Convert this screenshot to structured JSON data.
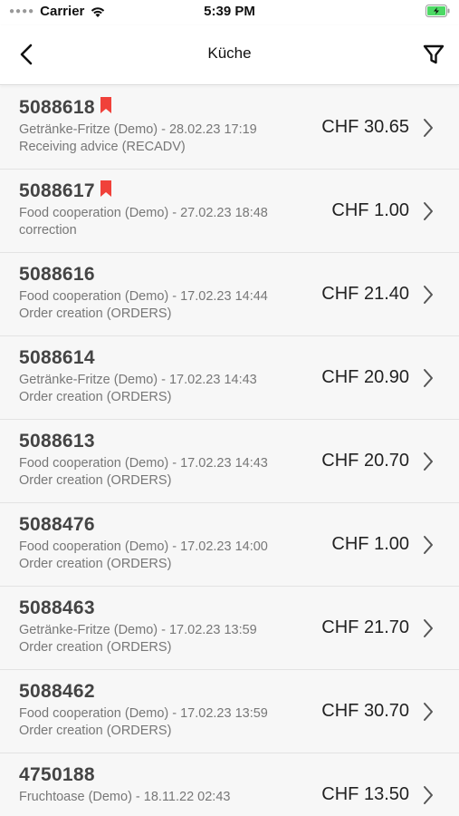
{
  "status_bar": {
    "carrier": "Carrier",
    "time": "5:39 PM"
  },
  "nav": {
    "title": "Küche",
    "back_icon": "chevron-left-icon",
    "filter_icon": "filter-funnel-icon"
  },
  "colors": {
    "bookmark": "#f0413a",
    "battery": "#4cd964"
  },
  "orders": [
    {
      "number": "5088618",
      "flagged": true,
      "supplier_date": "Getränke-Fritze (Demo) - 28.02.23 17:19",
      "type": "Receiving advice (RECADV)",
      "amount": "CHF 30.65"
    },
    {
      "number": "5088617",
      "flagged": true,
      "supplier_date": "Food cooperation (Demo) - 27.02.23 18:48",
      "type": "correction",
      "amount": "CHF 1.00"
    },
    {
      "number": "5088616",
      "flagged": false,
      "supplier_date": "Food cooperation (Demo) - 17.02.23 14:44",
      "type": "Order creation (ORDERS)",
      "amount": "CHF 21.40"
    },
    {
      "number": "5088614",
      "flagged": false,
      "supplier_date": "Getränke-Fritze (Demo) - 17.02.23 14:43",
      "type": "Order creation (ORDERS)",
      "amount": "CHF 20.90"
    },
    {
      "number": "5088613",
      "flagged": false,
      "supplier_date": "Food cooperation (Demo) - 17.02.23 14:43",
      "type": "Order creation (ORDERS)",
      "amount": "CHF 20.70"
    },
    {
      "number": "5088476",
      "flagged": false,
      "supplier_date": "Food cooperation (Demo) - 17.02.23 14:00",
      "type": "Order creation (ORDERS)",
      "amount": "CHF 1.00"
    },
    {
      "number": "5088463",
      "flagged": false,
      "supplier_date": "Getränke-Fritze (Demo) - 17.02.23 13:59",
      "type": "Order creation (ORDERS)",
      "amount": "CHF 21.70"
    },
    {
      "number": "5088462",
      "flagged": false,
      "supplier_date": "Food cooperation (Demo) - 17.02.23 13:59",
      "type": "Order creation (ORDERS)",
      "amount": "CHF 30.70"
    },
    {
      "number": "4750188",
      "flagged": false,
      "supplier_date": "Fruchtoase (Demo) - 18.11.22 02:43",
      "type": "",
      "amount": "CHF 13.50"
    }
  ]
}
